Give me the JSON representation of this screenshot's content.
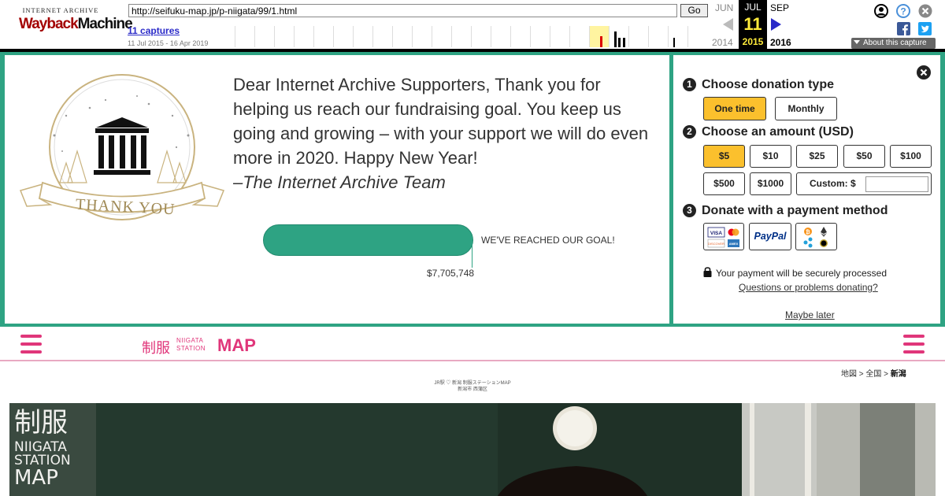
{
  "wayback": {
    "logo_top": "INTERNET ARCHIVE",
    "logo_way": "Wayback",
    "logo_machine": "Machine",
    "url": "http://seifuku-map.jp/p-niigata/99/1.html",
    "go_label": "Go",
    "captures": "11 captures",
    "date_range": "11 Jul 2015 - 16 Apr 2019",
    "prev_month": "JUN",
    "cur_month": "JUL",
    "next_month": "SEP",
    "cur_day": "11",
    "prev_year": "2014",
    "cur_year": "2015",
    "next_year": "2016",
    "about_label": "About this capture"
  },
  "donation": {
    "message": "Dear Internet Archive Supporters, Thank you for helping us reach our fundraising goal. You keep us going and growing – with your support we will do even more in 2020. Happy New Year!",
    "signature": "–The Internet Archive Team",
    "thank_you": "THANK YOU",
    "goal_text": "WE'VE REACHED OUR GOAL!",
    "goal_amount": "$7,705,748",
    "step1": "Choose donation type",
    "step2": "Choose an amount (USD)",
    "step3": "Donate with a payment method",
    "type_onetime": "One time",
    "type_monthly": "Monthly",
    "amounts": [
      "$5",
      "$10",
      "$25",
      "$50",
      "$100",
      "$500",
      "$1000"
    ],
    "custom_label": "Custom: $",
    "paypal": "PayPal",
    "secure_text": "Your payment will be securely processed",
    "questions": "Questions or problems donating?",
    "maybe_later": "Maybe later"
  },
  "site": {
    "logo_kanji": "制服",
    "logo_small1": "NIIGATA",
    "logo_small2": "STATION",
    "logo_map": "MAP",
    "crumb_map": "地図",
    "crumb_sep1": " > ",
    "crumb_all": "全国",
    "crumb_sep2": " > ",
    "crumb_region": "新潟",
    "subtitle1": "JR駅 ♡ 新潟 制服ステーションMAP",
    "subtitle2": "新潟市 西蒲区",
    "hero_text1": "制服",
    "hero_text2": "NIIGATA",
    "hero_text3": "STATION",
    "hero_text4": "MAP"
  },
  "colors": {
    "donation_green": "#2ea383",
    "selected_yellow": "#fbc02d",
    "site_pink": "#e0367a"
  }
}
